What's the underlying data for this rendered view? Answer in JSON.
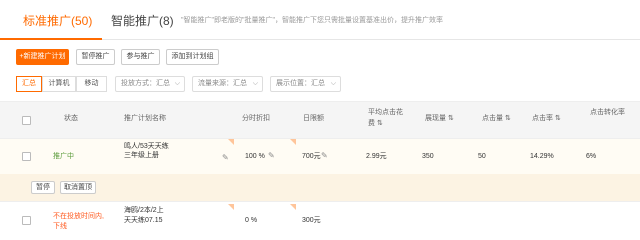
{
  "tabs": {
    "standard": "标准推广(50)",
    "smart": "智能推广(8)",
    "description": "\"智能推广\"即老版的\"批量推广\"，智能推广下您只需批量设置基准出价，提升推广效率"
  },
  "toolbar": {
    "new_plan": "+新建推广计划",
    "pause": "暂停推广",
    "join": "参与推广",
    "add_group": "添加到计划组"
  },
  "filters": {
    "segments": [
      "汇总",
      "计算机",
      "移动"
    ],
    "delivery": "投放方式：汇总",
    "traffic": "流量来源：汇总",
    "position": "展示位置：汇总"
  },
  "table": {
    "headers": {
      "status": "状态",
      "plan_name": "推广计划名称",
      "time_discount": "分时折扣",
      "daily_budget": "日限额",
      "avg_cost_1": "平均点击花",
      "avg_cost_2": "费 ⇅",
      "impressions": "展现量 ⇅",
      "clicks": "点击量 ⇅",
      "ctr": "点击率 ⇅",
      "cvr": "点击转化率"
    },
    "rows": [
      {
        "status": "推广中",
        "name_1": "鸣人/53天天练",
        "name_2": "三年级上册",
        "discount": "100 %",
        "budget": "700元",
        "avg_cost": "2.99元",
        "impressions": "350",
        "clicks": "50",
        "ctr": "14.29%",
        "cvr": "6%"
      },
      {
        "status_1": "不在投放时间内,",
        "status_2": "下线",
        "name_1": "海鸥/2本/2上",
        "name_2": "天天练07.15",
        "discount": "0 %",
        "budget": "300元"
      }
    ],
    "row_actions": {
      "pause": "暂停",
      "unpin": "取消置顶"
    }
  },
  "colors": {
    "accent": "#ff6a00",
    "status_active": "#5b9b3a",
    "status_offline": "#ff5a1f"
  }
}
